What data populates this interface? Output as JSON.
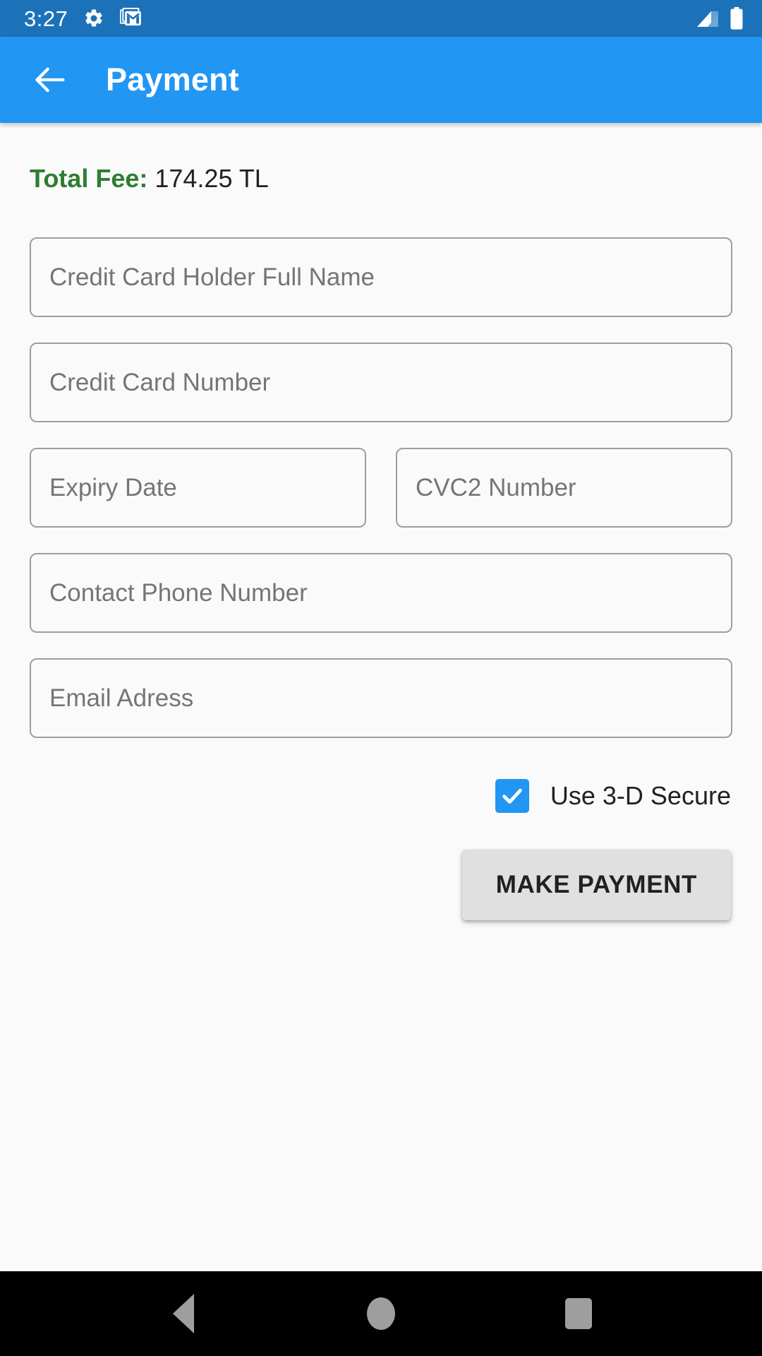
{
  "status_bar": {
    "time": "3:27",
    "icons": [
      "gear-icon",
      "gmail-icon",
      "signal-icon",
      "battery-icon"
    ],
    "background_color": "#1C72B8"
  },
  "app_bar": {
    "back_icon": "arrow-left-icon",
    "title": "Payment",
    "background_color": "#2196F3",
    "text_color": "#FFFFFF"
  },
  "main": {
    "total_fee": {
      "label": "Total Fee:",
      "value": "174.25 TL",
      "label_color": "#2E7D32",
      "value_color": "#212121"
    },
    "fields": [
      {
        "name": "card-holder-name",
        "placeholder": "Credit Card Holder Full Name",
        "value": ""
      },
      {
        "name": "card-number",
        "placeholder": "Credit Card Number",
        "value": ""
      },
      {
        "name": "expiry-date",
        "placeholder": "Expiry Date",
        "value": ""
      },
      {
        "name": "cvc2-number",
        "placeholder": "CVC2 Number",
        "value": ""
      },
      {
        "name": "contact-phone",
        "placeholder": "Contact Phone Number",
        "value": ""
      },
      {
        "name": "email-address",
        "placeholder": "Email Adress",
        "value": ""
      }
    ],
    "checkbox": {
      "label": "Use 3-D Secure",
      "checked": true,
      "checked_color": "#2196F3"
    },
    "submit_button": {
      "label": "MAKE PAYMENT",
      "background_color": "#E0E0E0",
      "text_color": "#212121"
    },
    "background_color": "#FAFAFA"
  },
  "nav_bar": {
    "back_icon": "triangle-back-icon",
    "home_icon": "circle-home-icon",
    "recents_icon": "square-recents-icon",
    "background_color": "#000000",
    "icon_color": "#9E9E9E"
  }
}
